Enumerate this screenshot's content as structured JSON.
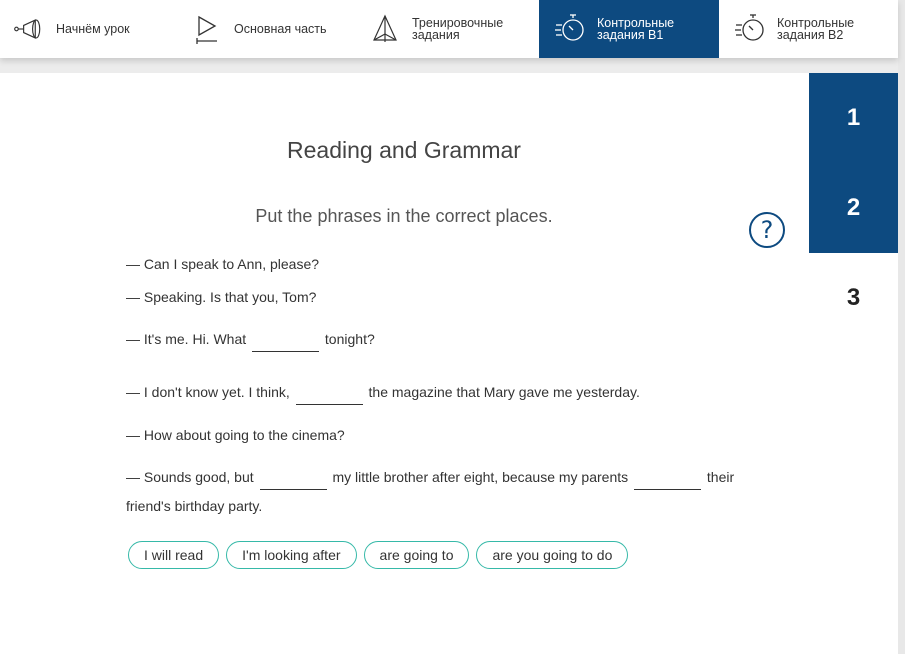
{
  "nav": {
    "items": [
      {
        "label": "Начнём урок",
        "icon": "megaphone-icon"
      },
      {
        "label": "Основная часть",
        "icon": "play-icon"
      },
      {
        "label": "Тренировочные задания",
        "icon": "pyramid-icon"
      },
      {
        "label": "Контрольные задания B1",
        "icon": "stopwatch-icon",
        "active": true
      },
      {
        "label": "Контрольные задания B2",
        "icon": "stopwatch-icon"
      }
    ]
  },
  "exercise": {
    "title": "Reading and Grammar",
    "instruction": "Put the phrases in the correct places.",
    "help": "?",
    "lines": {
      "l1": "— Can I speak to Ann, please?",
      "l2": "— Speaking. Is that you, Tom?",
      "l3a": "— It's me. Hi. What",
      "l3b": "tonight?",
      "l4a": "— I don't know yet. I think,",
      "l4b": "the magazine that Mary gave me yesterday.",
      "l5": "— How about going to the cinema?",
      "l6a": "— Sounds good, but",
      "l6b": "my little brother after eight, because my parents",
      "l6c": "their",
      "l6d": "friend's birthday party."
    },
    "phrases": [
      "I will read",
      "I'm looking after",
      "are going to",
      "are you going to do"
    ]
  },
  "sidebar": {
    "pages": [
      "1",
      "2",
      "3"
    ],
    "active_pages": [
      "1",
      "2"
    ]
  },
  "colors": {
    "primary": "#0d4a80",
    "chip_border": "#36b9a8"
  }
}
